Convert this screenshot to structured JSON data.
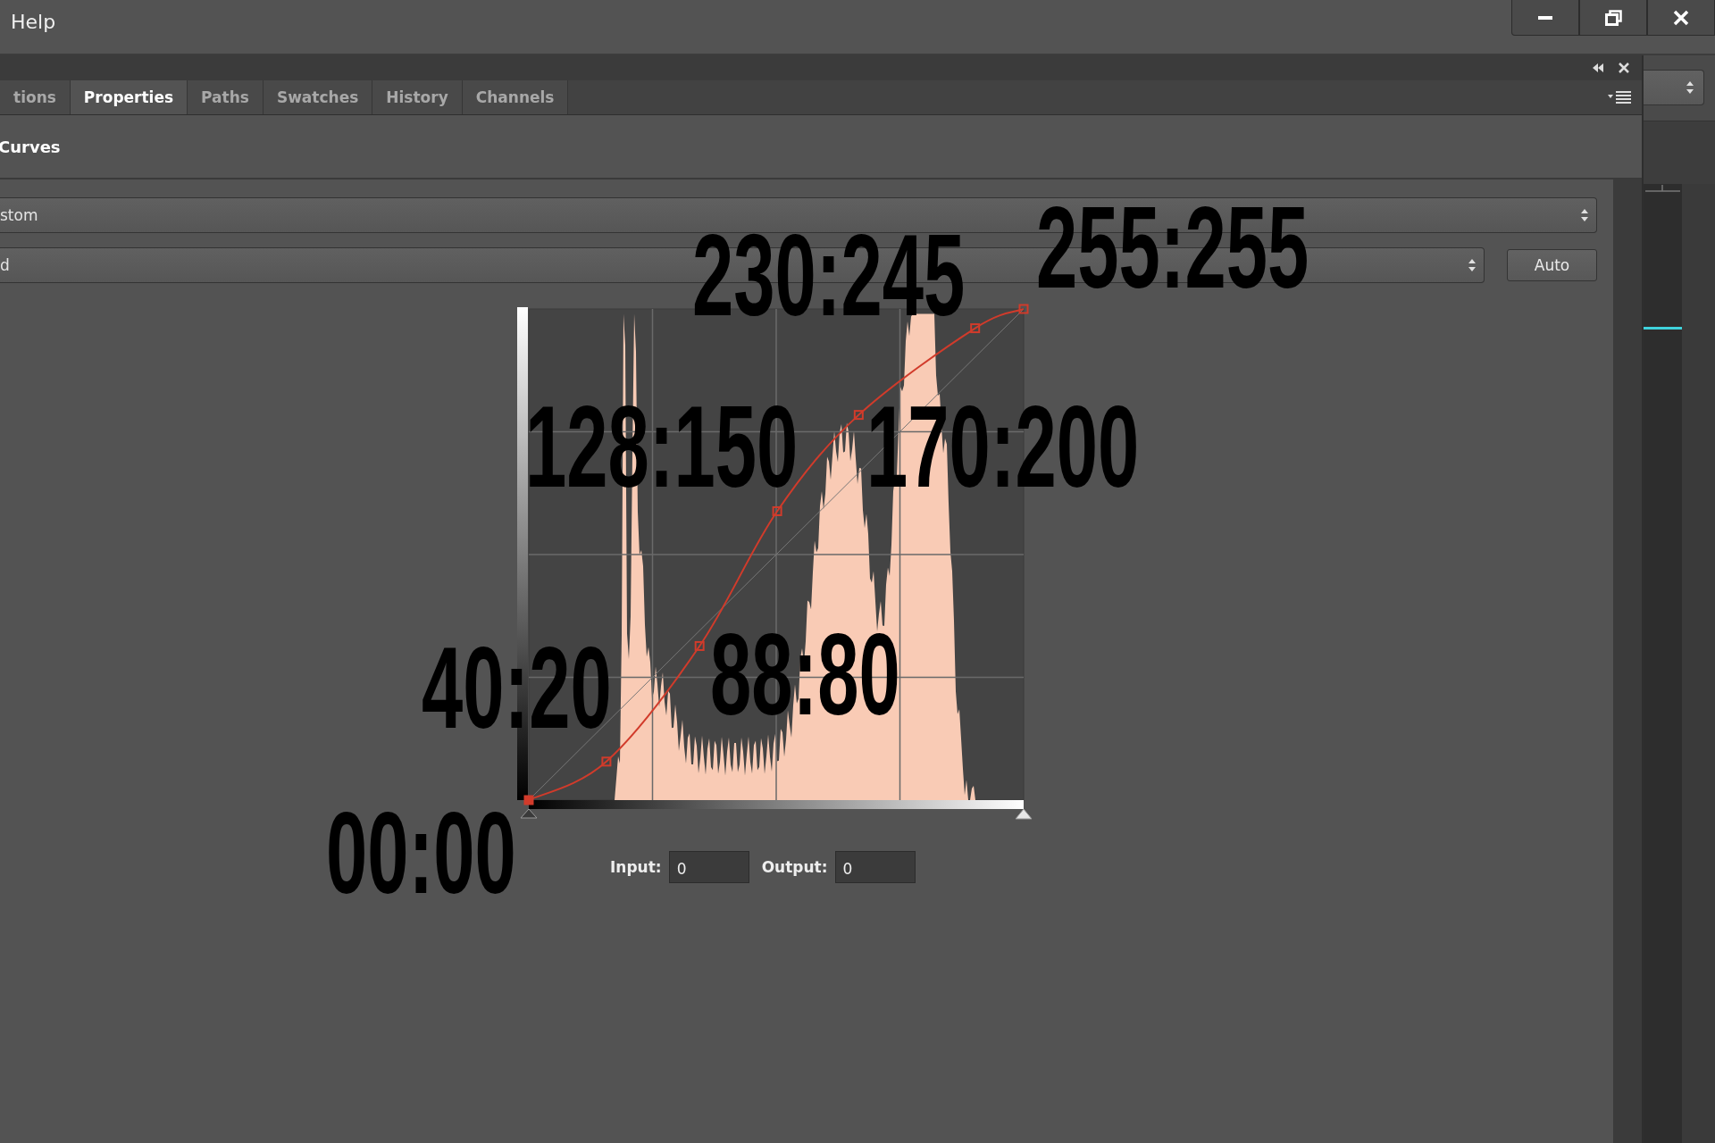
{
  "menu": [
    {
      "label": "Help"
    }
  ],
  "panel": {
    "tabs": [
      {
        "label": "tions",
        "selected": false
      },
      {
        "label": "Properties",
        "selected": true
      },
      {
        "label": "Paths",
        "selected": false
      },
      {
        "label": "Swatches",
        "selected": false
      },
      {
        "label": "History",
        "selected": false
      },
      {
        "label": "Channels",
        "selected": false
      }
    ],
    "title": "Curves",
    "preset": "stom",
    "channel": "d",
    "auto_button": "Auto",
    "point_labels": [
      {
        "text": "00:00",
        "selected": true
      },
      {
        "text": "40:20",
        "selected": false
      },
      {
        "text": "88:80",
        "selected": false
      },
      {
        "text": "128:150",
        "selected": false
      },
      {
        "text": "170:200",
        "selected": false
      },
      {
        "text": "230:245",
        "selected": false
      },
      {
        "text": "255:255",
        "selected": false
      }
    ],
    "input": {
      "label": "Input:",
      "value": "0"
    },
    "output": {
      "label": "Output:",
      "value": "0"
    }
  }
}
